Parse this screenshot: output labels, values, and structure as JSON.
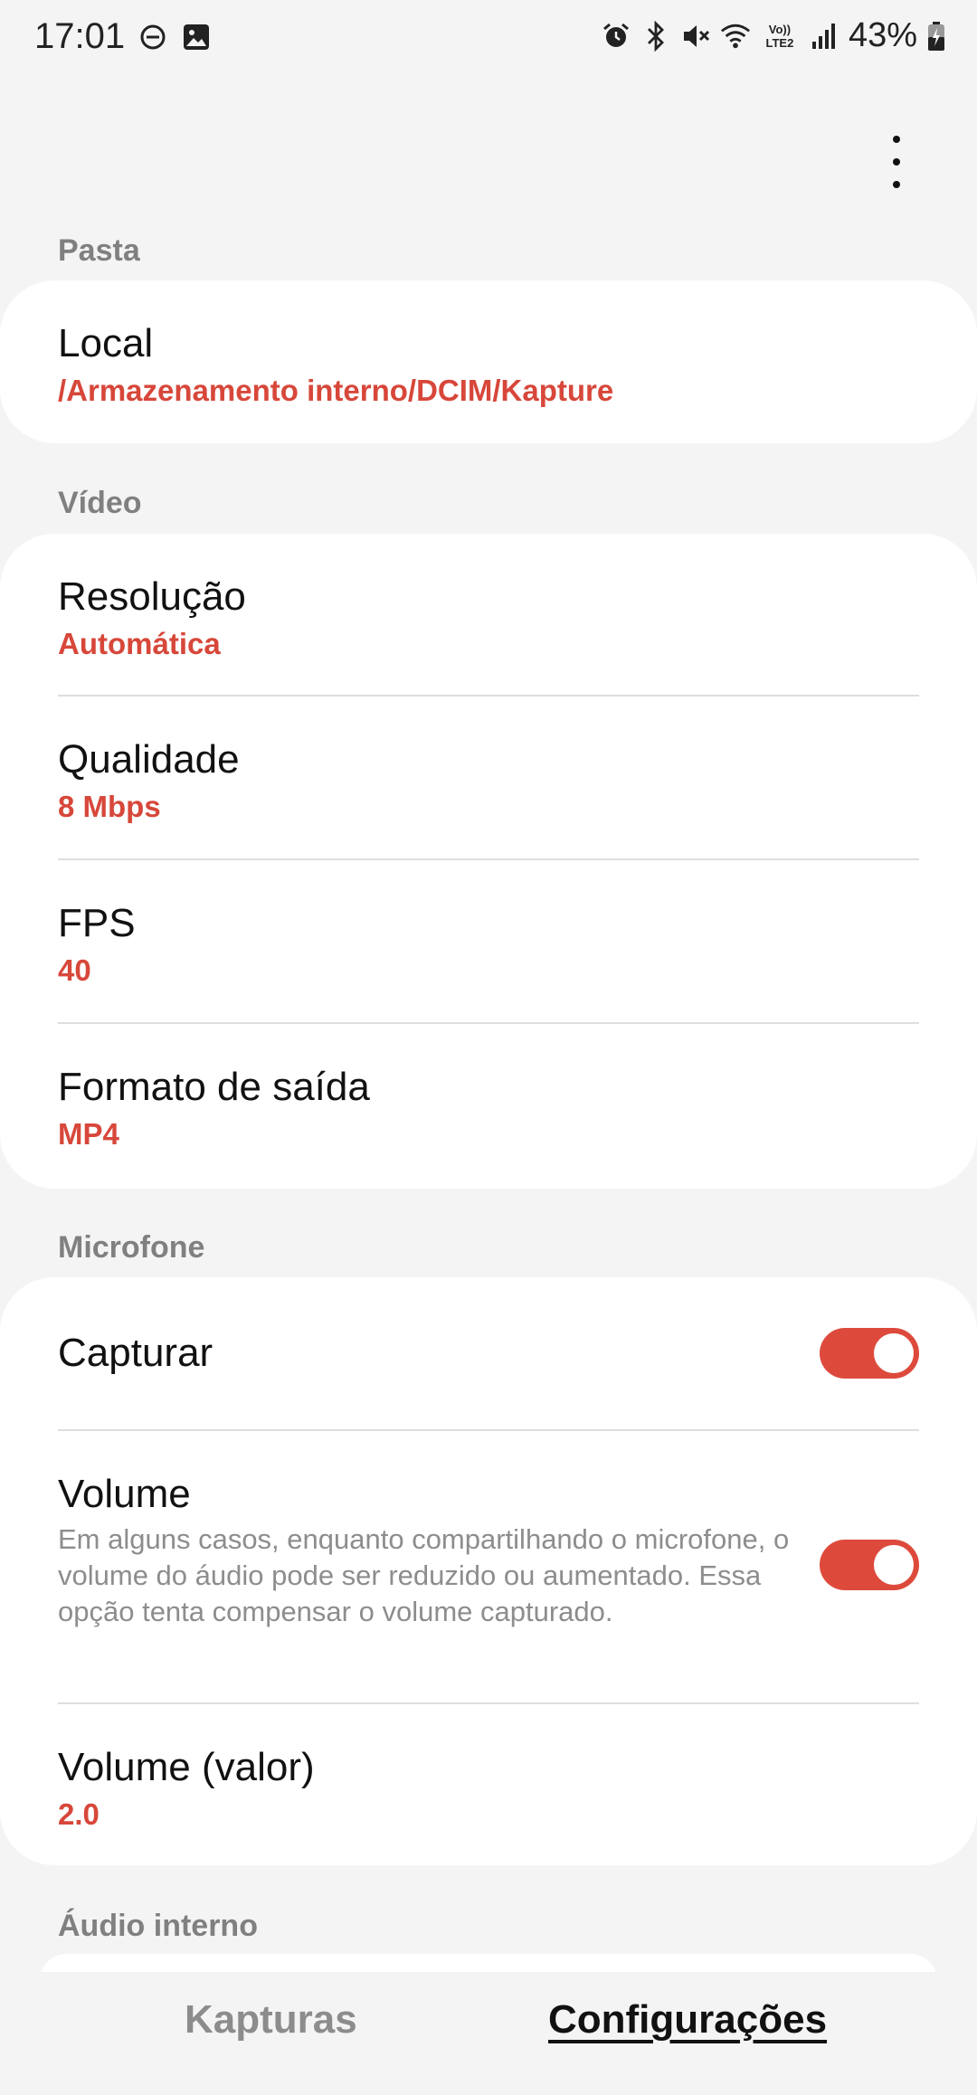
{
  "status_bar": {
    "time": "17:01",
    "left_icons": [
      "dnd-icon",
      "gallery-icon"
    ],
    "right_icons": [
      "alarm-icon",
      "bluetooth-icon",
      "mute-icon",
      "wifi-icon",
      "volte-icon",
      "signal-icon"
    ],
    "volte_label_top": "Vo))",
    "volte_label_bottom": "LTE2",
    "battery_percent": "43%",
    "battery_icon": "battery-charging-icon"
  },
  "toolbar": {
    "more_icon": "more-vertical-icon"
  },
  "sections": {
    "pasta": {
      "header": "Pasta",
      "local": {
        "title": "Local",
        "value": "/Armazenamento interno/DCIM/Kapture"
      }
    },
    "video": {
      "header": "Vídeo",
      "resolucao": {
        "title": "Resolução",
        "value": "Automática"
      },
      "qualidade": {
        "title": "Qualidade",
        "value": "8 Mbps"
      },
      "fps": {
        "title": "FPS",
        "value": "40"
      },
      "formato": {
        "title": "Formato de saída",
        "value": "MP4"
      }
    },
    "microfone": {
      "header": "Microfone",
      "capturar": {
        "title": "Capturar",
        "enabled": true
      },
      "volume": {
        "title": "Volume",
        "description": "Em alguns casos, enquanto compartilhando o microfone, o volume do áudio pode ser reduzido ou aumentado. Essa opção tenta compensar o volume capturado.",
        "enabled": true
      },
      "volume_valor": {
        "title": "Volume (valor)",
        "value": "2.0"
      }
    },
    "audio_interno": {
      "header": "Áudio interno"
    }
  },
  "bottom_nav": {
    "tabs": [
      {
        "label": "Kapturas",
        "active": false
      },
      {
        "label": "Configurações",
        "active": true
      }
    ]
  },
  "colors": {
    "accent": "#d7473a",
    "toggle_on": "#dd4a3c",
    "background": "#f4f4f4",
    "section_header": "#808080"
  }
}
